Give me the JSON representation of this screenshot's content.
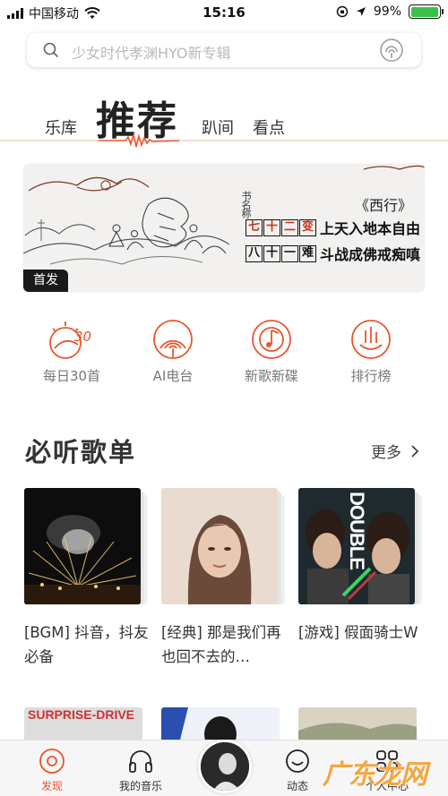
{
  "status_bar": {
    "carrier": "中国移动",
    "time": "15:16",
    "battery": "99%",
    "battery_level": 0.99
  },
  "search": {
    "placeholder": "少女时代孝渊HYO新专辑",
    "left_icon": "search-icon",
    "right_icon": "voice-recognize-icon"
  },
  "tabs": [
    {
      "label": "乐库",
      "active": false
    },
    {
      "label": "推荐",
      "active": true
    },
    {
      "label": "趴间",
      "active": false
    },
    {
      "label": "看点",
      "active": false
    }
  ],
  "banner": {
    "badge": "首发",
    "title": "《西行》",
    "author": "书名称",
    "line1_boxes": [
      "七",
      "十",
      "二",
      "变"
    ],
    "line1_text": "上天入地本自由",
    "line2_boxes": [
      "八",
      "十",
      "一",
      "难"
    ],
    "line2_text": "斗战成佛戒痴嗔"
  },
  "quick_entries": [
    {
      "label": "每日30首",
      "icon": "daily-30-icon"
    },
    {
      "label": "AI电台",
      "icon": "ai-radio-icon"
    },
    {
      "label": "新歌新碟",
      "icon": "new-album-icon"
    },
    {
      "label": "排行榜",
      "icon": "chart-rank-icon"
    }
  ],
  "section": {
    "title": "必听歌单",
    "more": "更多"
  },
  "playlists": [
    {
      "name": "[BGM] 抖音，抖友必备"
    },
    {
      "name": "[经典] 那是我们再也回不去的…"
    },
    {
      "name": "[游戏] 假面骑士W",
      "cover_text": "DOUBLE"
    }
  ],
  "row2_covers": [
    {
      "cover_text": "SURPRISE-DRIVE"
    }
  ],
  "bottom_nav": [
    {
      "label": "发现",
      "icon": "discover-icon",
      "active": true
    },
    {
      "label": "我的音乐",
      "icon": "headphones-icon",
      "active": false
    },
    {
      "label": "动态",
      "icon": "smile-icon",
      "active": false
    },
    {
      "label": "个人中心",
      "icon": "grid-icon",
      "active": false
    }
  ],
  "watermark": "广东龙网",
  "colors": {
    "accent": "#e8562e",
    "battery_green": "#3bc14a",
    "seal_red": "#c8321c"
  }
}
